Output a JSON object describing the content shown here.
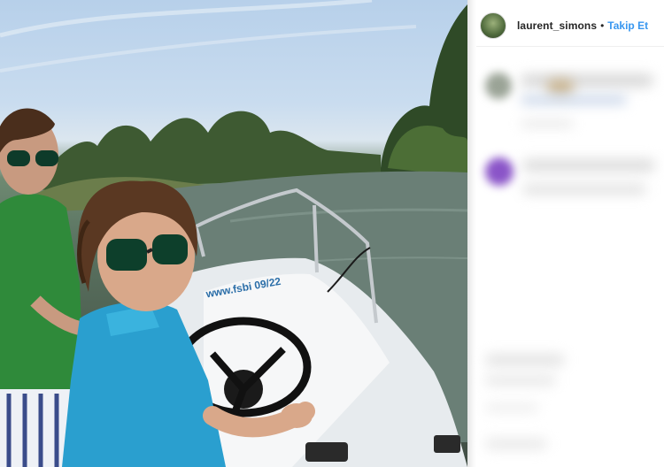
{
  "post": {
    "username": "laurent_simons",
    "separator": "•",
    "follow_label": "Takip Et"
  },
  "photo": {
    "boat_text": "www.fsbi 09/22"
  },
  "colors": {
    "follow_blue": "#3897f0",
    "username_text": "#262626",
    "sidebar_bg": "#ffffff"
  }
}
